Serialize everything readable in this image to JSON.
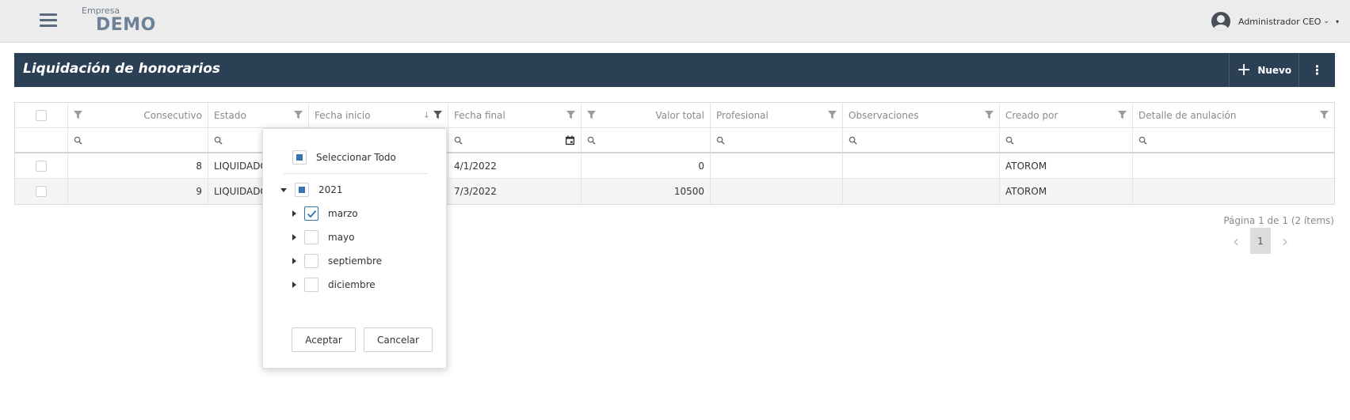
{
  "topbar": {
    "company_label": "Empresa",
    "company_name": "DEMO",
    "user_name": "Administrador CEO",
    "user_chevron": "⌄",
    "user_caret": "▾"
  },
  "page": {
    "title": "Liquidación de honorarios",
    "new_button": "Nuevo",
    "new_icon": "+",
    "more_icon": "⋮"
  },
  "grid": {
    "columns": [
      {
        "label": "Consecutivo"
      },
      {
        "label": "Estado"
      },
      {
        "label": "Fecha inicio"
      },
      {
        "label": "Fecha final"
      },
      {
        "label": "Valor total"
      },
      {
        "label": "Profesional"
      },
      {
        "label": "Observaciones"
      },
      {
        "label": "Creado por"
      },
      {
        "label": "Detalle de anulación"
      }
    ],
    "rows": [
      {
        "consecutivo": "8",
        "estado": "LIQUIDADO",
        "fecha_inicio": "",
        "fecha_final": "4/1/2022",
        "valor_total": "0",
        "profesional": "",
        "observaciones": "",
        "creado_por": "ATOROM",
        "detalle": ""
      },
      {
        "consecutivo": "9",
        "estado": "LIQUIDADO",
        "fecha_inicio": "",
        "fecha_final": "7/3/2022",
        "valor_total": "10500",
        "profesional": "",
        "observaciones": "",
        "creado_por": "ATOROM",
        "detalle": ""
      }
    ]
  },
  "pager": {
    "info": "Página 1 de 1 (2 ítems)",
    "page": "1",
    "prev": "‹",
    "next": "›"
  },
  "filter_popup": {
    "select_all": "Seleccionar Todo",
    "year": "2021",
    "months": [
      {
        "label": "marzo",
        "checked": true
      },
      {
        "label": "mayo",
        "checked": false
      },
      {
        "label": "septiembre",
        "checked": false
      },
      {
        "label": "diciembre",
        "checked": false
      }
    ],
    "accept": "Aceptar",
    "cancel": "Cancelar"
  },
  "colors": {
    "header_bg": "#2b3f55",
    "accent": "#3373b5",
    "topbar_bg": "#ececec"
  }
}
